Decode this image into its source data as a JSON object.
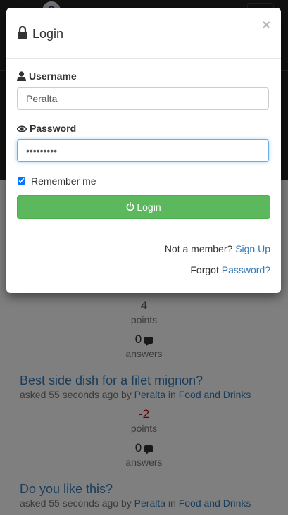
{
  "nav": {
    "logo_char": "?"
  },
  "modal": {
    "title": "Login",
    "close_label": "×",
    "username": {
      "label": "Username",
      "value": "Peralta"
    },
    "password": {
      "label": "Password",
      "value": "•••••••••"
    },
    "remember_label": "Remember me",
    "submit_label": "Login",
    "footer": {
      "not_member_text": "Not a member?",
      "signup_link": "Sign Up",
      "forgot_text": "Forgot",
      "password_link": "Password?"
    }
  },
  "questions": [
    {
      "points": "4",
      "points_label": "points",
      "answers": "0",
      "answers_label": "answers"
    },
    {
      "title": "Best side dish for a filet mignon?",
      "asked_prefix": "asked 55 seconds ago by",
      "user": "Peralta",
      "in_word": "in",
      "category": "Food and Drinks",
      "points": "-2",
      "points_label": "points",
      "answers": "0",
      "answers_label": "answers"
    },
    {
      "title": "Do you like this?",
      "asked_prefix": "asked 55 seconds ago by",
      "user": "Peralta",
      "in_word": "in",
      "category": "Food and Drinks"
    }
  ],
  "colors": {
    "navbar": "#222222",
    "success": "#5cb85c",
    "link": "#337ab7",
    "positive": "#3c763d",
    "negative": "#cc0000"
  }
}
